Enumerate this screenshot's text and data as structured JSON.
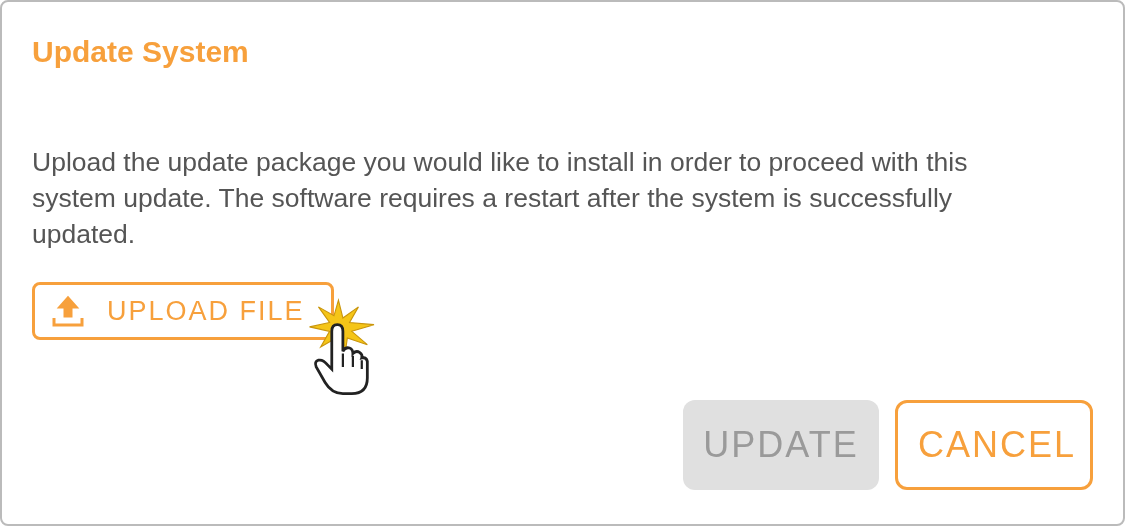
{
  "dialog": {
    "title": "Update System",
    "message": "Upload the update package you would like to install in order to proceed with this system update. The software requires a restart after the system is successfully updated.",
    "upload_button": {
      "label": "UPLOAD FILE",
      "hovered": true
    },
    "buttons": [
      {
        "label": "UPDATE",
        "kind": "filled",
        "disabled": true
      },
      {
        "label": "CANCEL",
        "kind": "outlined",
        "disabled": false
      }
    ]
  }
}
